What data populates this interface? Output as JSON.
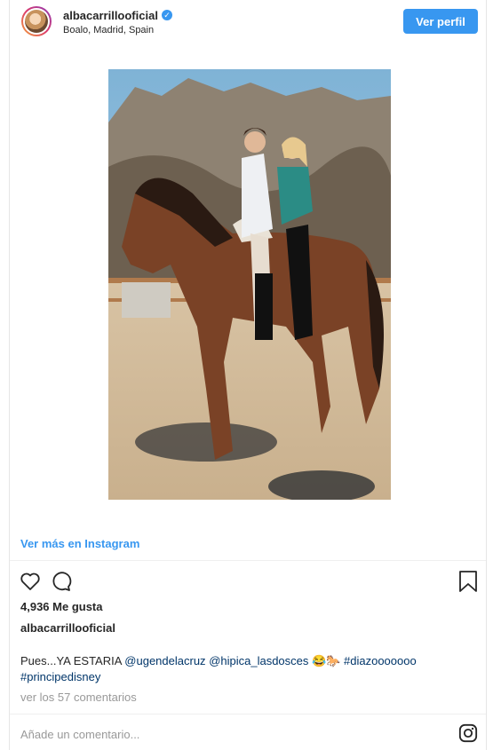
{
  "header": {
    "username": "albacarrillooficial",
    "verified_glyph": "✓",
    "location": "Boalo, Madrid, Spain",
    "profile_button": "Ver perfil"
  },
  "post": {
    "view_more": "Ver más en Instagram",
    "likes": "4,936 Me gusta",
    "caption_user": "albacarrillooficial",
    "caption": {
      "text_start": "Pues...YA ESTARIA ",
      "mention1": "@ugendelacruz",
      "mention2": "@hipica_lasdosces",
      "emoji": "😂🐎",
      "hashtag1": "#diazooooooo",
      "hashtag2": "#principedisney"
    },
    "comments_link": "ver los 57 comentarios",
    "comment_placeholder": "Añade un comentario..."
  },
  "colors": {
    "accent": "#3897f0",
    "text": "#262626",
    "muted": "#999999",
    "link": "#003569"
  },
  "icons": [
    "avatar",
    "verified-badge-icon",
    "heart-icon",
    "comment-icon",
    "bookmark-icon",
    "instagram-icon"
  ]
}
